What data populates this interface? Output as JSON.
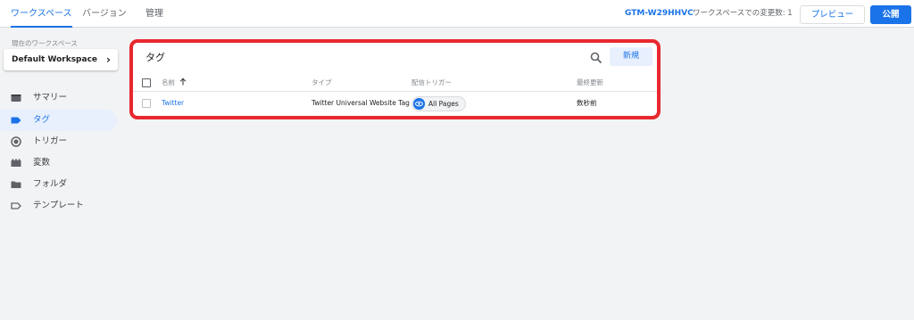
{
  "topbar": {
    "tabs": [
      {
        "label": "ワークスペース",
        "active": true
      },
      {
        "label": "バージョン",
        "active": false
      },
      {
        "label": "管理",
        "active": false
      }
    ],
    "container_id": "GTM-W29HHVC",
    "changes_text": "ワークスペースでの変更数: 1",
    "preview_label": "プレビュー",
    "publish_label": "公開"
  },
  "sidebar": {
    "workspace_label": "現在のワークスペース",
    "workspace_name": "Default Workspace",
    "items": [
      {
        "label": "サマリー",
        "icon": "summary-icon",
        "active": false
      },
      {
        "label": "タグ",
        "icon": "tag-icon",
        "active": true
      },
      {
        "label": "トリガー",
        "icon": "trigger-icon",
        "active": false
      },
      {
        "label": "変数",
        "icon": "variables-icon",
        "active": false
      },
      {
        "label": "フォルダ",
        "icon": "folder-icon",
        "active": false
      },
      {
        "label": "テンプレート",
        "icon": "template-icon",
        "active": false
      }
    ]
  },
  "tags_card": {
    "title": "タグ",
    "new_label": "新規",
    "columns": {
      "name": "名前",
      "type": "タイプ",
      "trigger": "配信トリガー",
      "updated": "最終更新"
    },
    "rows": [
      {
        "name": "Twitter",
        "type": "Twitter Universal Website Tag",
        "trigger": "All Pages",
        "updated": "数秒前"
      }
    ]
  },
  "colors": {
    "accent": "#1a73e8",
    "highlight_border": "#e8282e"
  }
}
